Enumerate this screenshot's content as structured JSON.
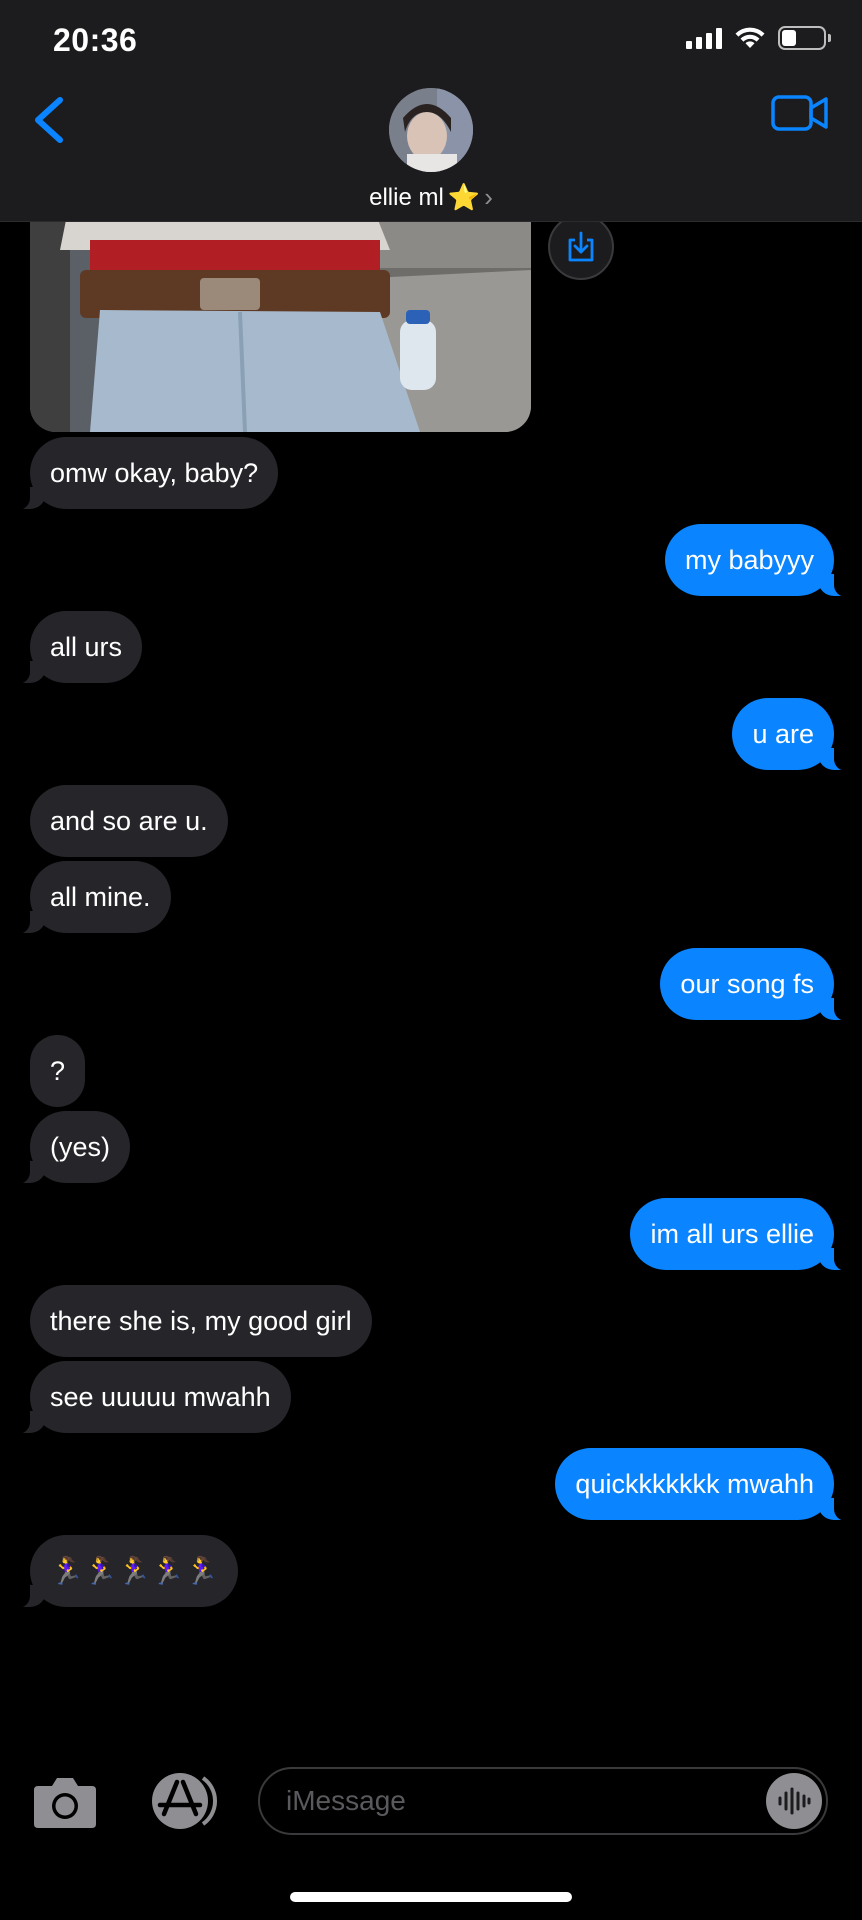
{
  "status_bar": {
    "time": "20:36",
    "battery_level_percent": 35,
    "icons": [
      "signal-icon",
      "wifi-icon",
      "battery-icon"
    ]
  },
  "header": {
    "contact_name": "ellie ml",
    "name_emoji": "⭐",
    "chevron": "›",
    "back_icon": "chevron-left-icon",
    "video_icon": "video-camera-icon"
  },
  "conversation": {
    "attachment": {
      "type": "photo",
      "save_icon": "save-download-icon"
    },
    "messages": [
      {
        "from": "them",
        "text": "omw okay, baby?"
      },
      {
        "from": "me",
        "text": "my babyyy"
      },
      {
        "from": "them",
        "text": "all urs"
      },
      {
        "from": "me",
        "text": "u are"
      },
      {
        "from": "them",
        "text": "and so are u."
      },
      {
        "from": "them",
        "text": "all mine."
      },
      {
        "from": "me",
        "text": "our song fs"
      },
      {
        "from": "them",
        "text": "?"
      },
      {
        "from": "them",
        "text": "(yes)"
      },
      {
        "from": "me",
        "text": "im all urs ellie"
      },
      {
        "from": "them",
        "text": "there she is, my good girl"
      },
      {
        "from": "them",
        "text": "see uuuuu mwahh"
      },
      {
        "from": "me",
        "text": "quickkkkkkk mwahh"
      },
      {
        "from": "them",
        "text": "🏃‍♀️🏃‍♀️🏃‍♀️🏃‍♀️🏃‍♀️"
      }
    ]
  },
  "input_bar": {
    "placeholder": "iMessage",
    "camera_icon": "camera-icon",
    "apps_icon": "app-store-icon",
    "audio_icon": "audio-waveform-icon"
  },
  "colors": {
    "background": "#000000",
    "header_background": "#1c1c1e",
    "incoming_bubble": "#26252a",
    "outgoing_bubble": "#0a84ff",
    "accent": "#0a84ff"
  }
}
